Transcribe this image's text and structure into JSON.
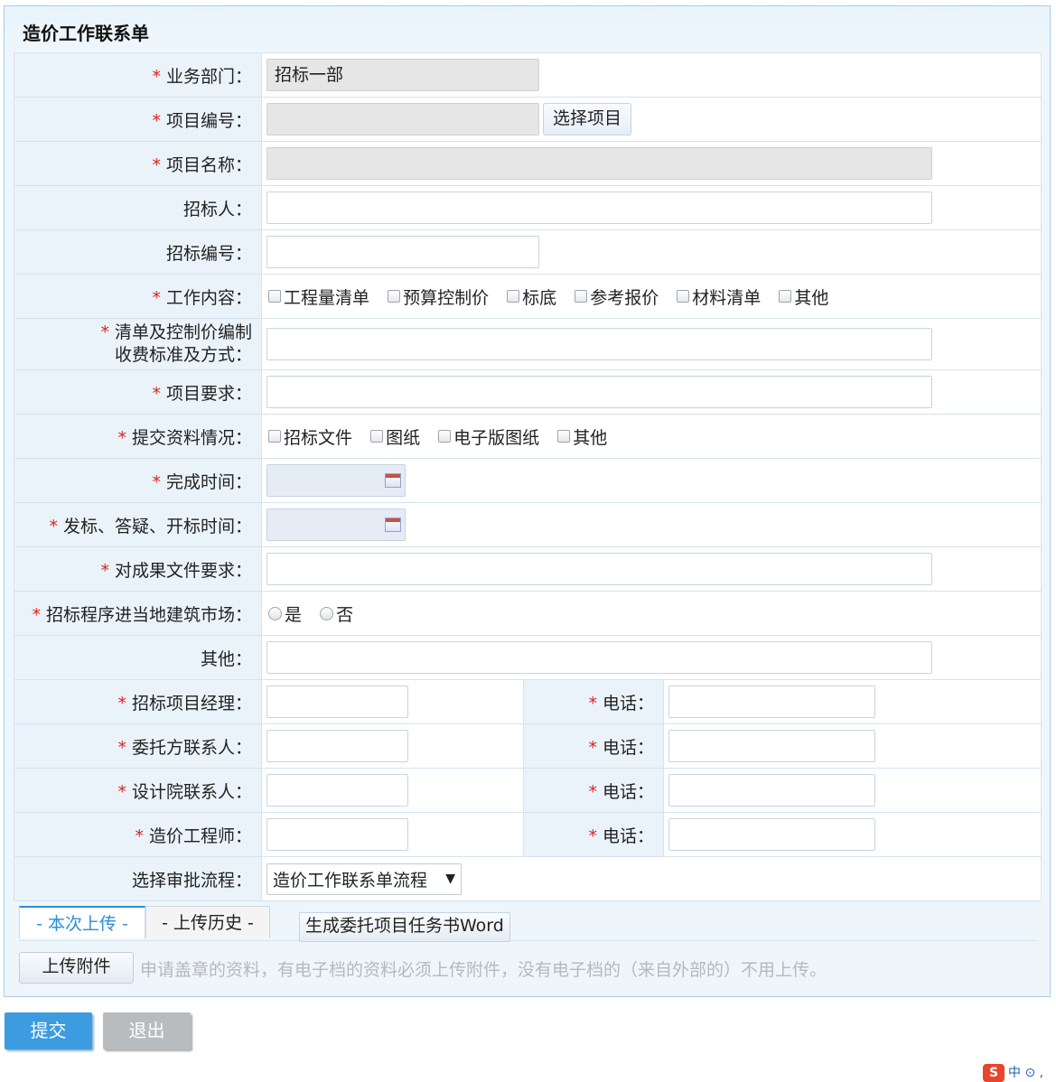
{
  "form": {
    "title": "造价工作联系单",
    "required_mark": "*",
    "rows": {
      "dept": {
        "label": "业务部门：",
        "value": "招标一部"
      },
      "project_no": {
        "label": "项目编号：",
        "value": "",
        "button": "选择项目"
      },
      "project_name": {
        "label": "项目名称：",
        "value": ""
      },
      "tenderer": {
        "label": "招标人：",
        "value": ""
      },
      "tender_no": {
        "label": "招标编号：",
        "value": ""
      },
      "work_content": {
        "label": "工作内容：",
        "options": [
          "工程量清单",
          "预算控制价",
          "标底",
          "参考报价",
          "材料清单",
          "其他"
        ]
      },
      "fee": {
        "label_line1": "清单及控制价编制",
        "label_line2": "收费标准及方式：",
        "value": ""
      },
      "requirement": {
        "label": "项目要求：",
        "value": ""
      },
      "materials": {
        "label": "提交资料情况：",
        "options": [
          "招标文件",
          "图纸",
          "电子版图纸",
          "其他"
        ]
      },
      "finish_time": {
        "label": "完成时间：",
        "value": ""
      },
      "bid_time": {
        "label": "发标、答疑、开标时间：",
        "value": ""
      },
      "result_req": {
        "label": "对成果文件要求：",
        "value": ""
      },
      "local_market": {
        "label": "招标程序进当地建筑市场：",
        "options": [
          "是",
          "否"
        ]
      },
      "other": {
        "label": "其他：",
        "value": ""
      },
      "manager": {
        "label": "招标项目经理：",
        "phone_label": "电话："
      },
      "client_contact": {
        "label": "委托方联系人：",
        "phone_label": "电话："
      },
      "design_contact": {
        "label": "设计院联系人：",
        "phone_label": "电话："
      },
      "cost_engineer": {
        "label": "造价工程师：",
        "phone_label": "电话："
      },
      "approval": {
        "label": "选择审批流程：",
        "selected": "造价工作联系单流程"
      }
    }
  },
  "tabs": [
    "- 本次上传 -",
    "- 上传历史 -"
  ],
  "word_button": "生成委托项目任务书Word",
  "upload": {
    "button": "上传附件",
    "hint": "申请盖章的资料，有电子档的资料必须上传附件，没有电子档的（来自外部的）不用上传。"
  },
  "actions": {
    "submit": "提交",
    "exit": "退出"
  },
  "ime": {
    "logo": "S",
    "text": "中 ⊙ ,"
  }
}
